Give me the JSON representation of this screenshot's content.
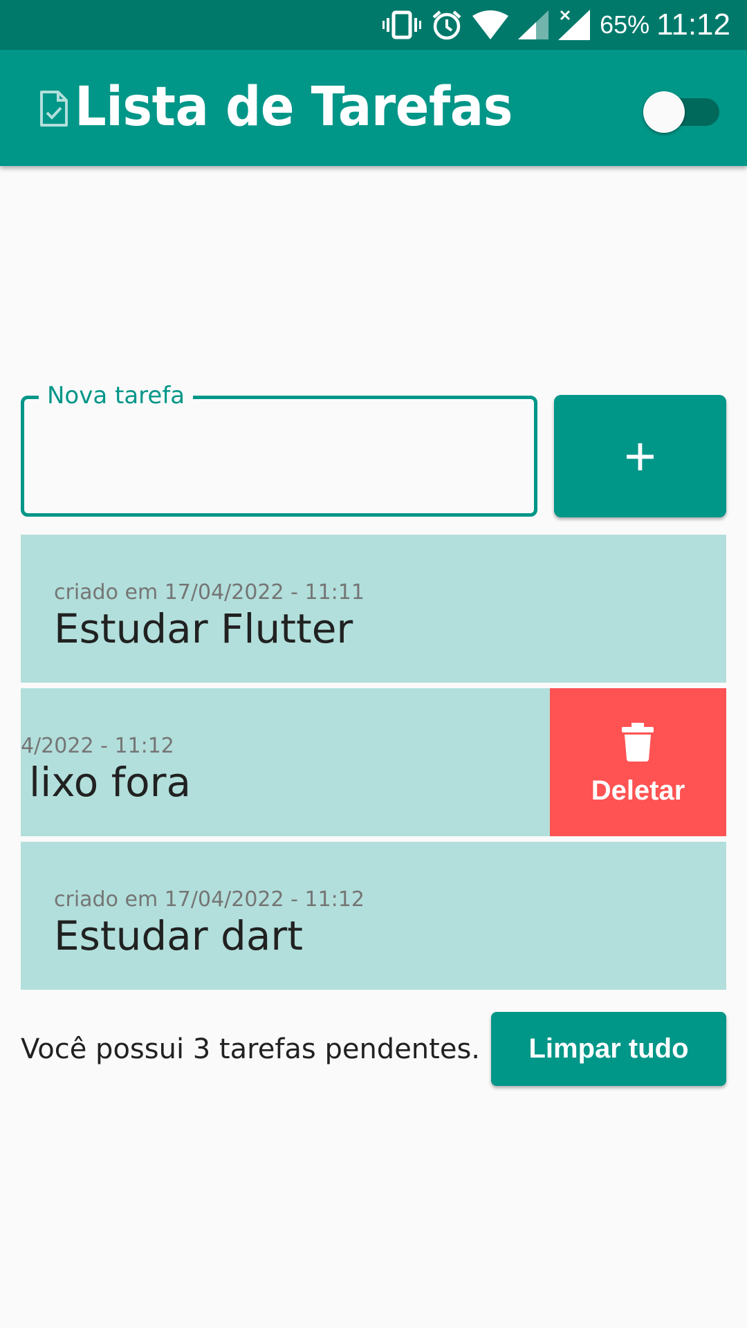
{
  "status_bar": {
    "battery_percent": "65%",
    "clock": "11:12",
    "icons": [
      "vibrate-icon",
      "alarm-icon",
      "wifi-icon",
      "signal-icon",
      "no-signal-icon"
    ]
  },
  "app_bar": {
    "title": "Lista de Tarefas",
    "icon": "document-check-icon",
    "theme_switch_on": false
  },
  "new_task": {
    "label": "Nova tarefa",
    "value": "",
    "add_label": "+"
  },
  "tasks": [
    {
      "date": "criado em 17/04/2022 - 11:11",
      "title": "Estudar Flutter",
      "swiped": false
    },
    {
      "date": "4/2022 - 11:12",
      "title": "lixo fora",
      "swiped": true,
      "delete_label": "Deletar"
    },
    {
      "date": "criado em 17/04/2022 - 11:12",
      "title": "Estudar dart",
      "swiped": false
    }
  ],
  "footer": {
    "pending_text": "Você possui 3 tarefas pendentes.",
    "clear_label": "Limpar tudo"
  },
  "colors": {
    "primary": "#009688",
    "primary_dark": "#00796b",
    "task_bg": "#b2dfdb",
    "delete_bg": "#ff5252",
    "background": "#fafafa"
  }
}
